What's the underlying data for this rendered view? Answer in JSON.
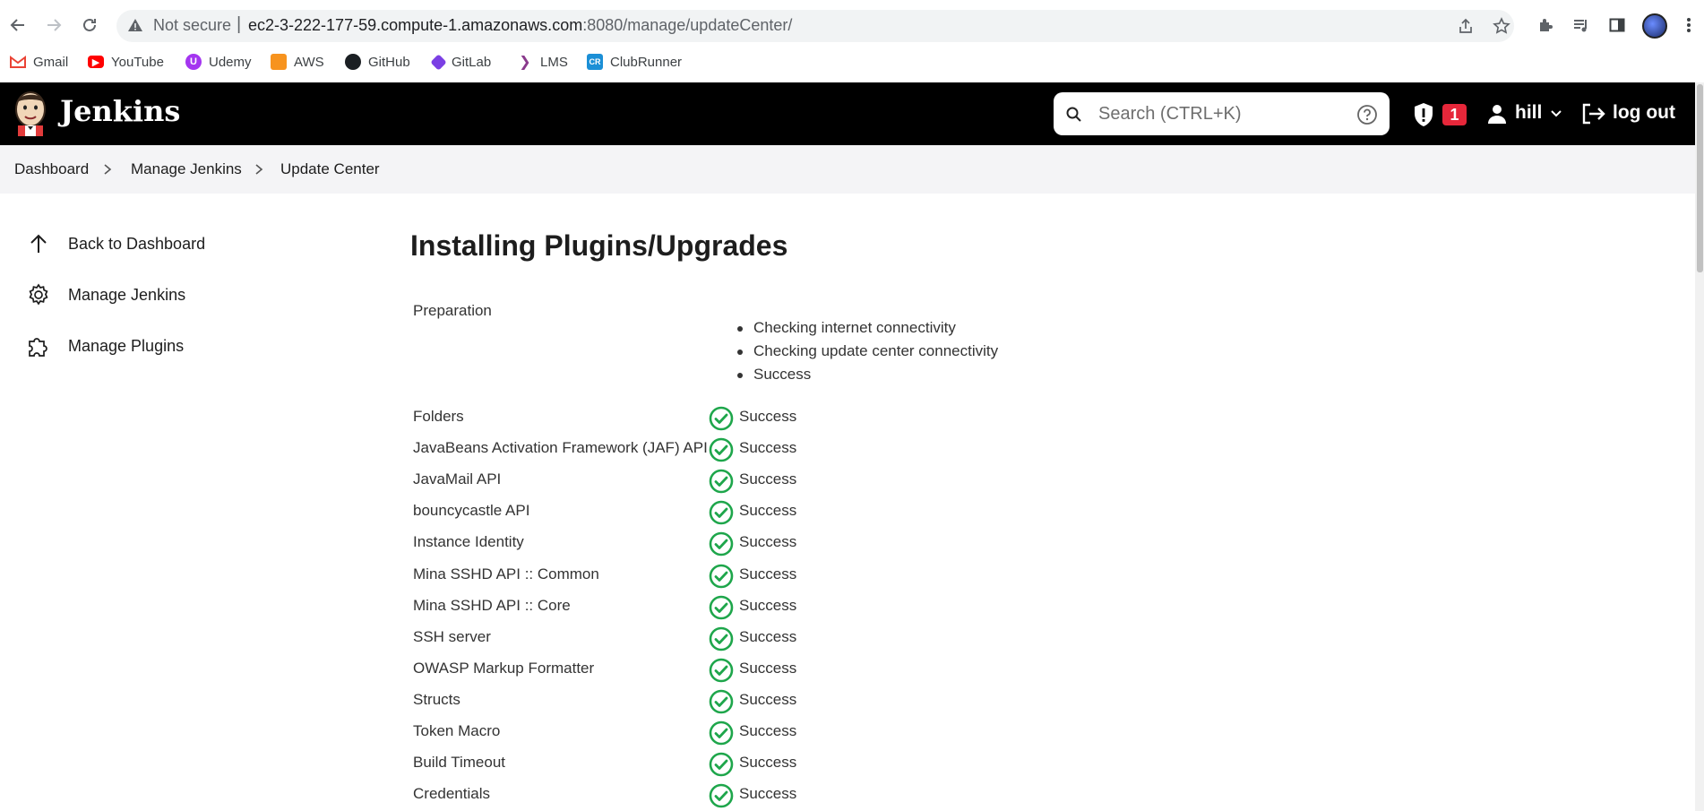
{
  "browser": {
    "security_label": "Not secure",
    "url_host": "ec2-3-222-177-59.compute-1.amazonaws.com",
    "url_rest": ":8080/manage/updateCenter/"
  },
  "bookmarks": [
    {
      "label": "Gmail",
      "icon": "gmail-icon",
      "color": "#ea4335"
    },
    {
      "label": "YouTube",
      "icon": "youtube-icon",
      "color": "#ff0000"
    },
    {
      "label": "Udemy",
      "icon": "udemy-icon",
      "color": "#a435f0"
    },
    {
      "label": "AWS",
      "icon": "aws-icon",
      "color": "#f7931e"
    },
    {
      "label": "GitHub",
      "icon": "github-icon",
      "color": "#1b1f23"
    },
    {
      "label": "GitLab",
      "icon": "gitlab-icon",
      "color": "#7b3fe4"
    },
    {
      "label": "LMS",
      "icon": "lms-icon",
      "color": "#8a3a8c"
    },
    {
      "label": "ClubRunner",
      "icon": "clubrunner-icon",
      "color": "#1b8fd6"
    }
  ],
  "header": {
    "app_title": "Jenkins",
    "search_placeholder": "Search (CTRL+K)",
    "alert_count": "1",
    "username": "hill",
    "logout_label": "log out"
  },
  "breadcrumb": [
    "Dashboard",
    "Manage Jenkins",
    "Update Center"
  ],
  "sidebar": {
    "items": [
      {
        "label": "Back to Dashboard",
        "icon": "arrow-up-icon"
      },
      {
        "label": "Manage Jenkins",
        "icon": "gear-icon"
      },
      {
        "label": "Manage Plugins",
        "icon": "puzzle-icon"
      }
    ]
  },
  "main": {
    "title": "Installing Plugins/Upgrades",
    "preparation": {
      "label": "Preparation",
      "steps": [
        "Checking internet connectivity",
        "Checking update center connectivity",
        "Success"
      ]
    },
    "plugins": [
      {
        "name": "Folders",
        "status": "Success"
      },
      {
        "name": "JavaBeans Activation Framework (JAF) API",
        "status": "Success"
      },
      {
        "name": "JavaMail API",
        "status": "Success"
      },
      {
        "name": "bouncycastle API",
        "status": "Success"
      },
      {
        "name": "Instance Identity",
        "status": "Success"
      },
      {
        "name": "Mina SSHD API :: Common",
        "status": "Success"
      },
      {
        "name": "Mina SSHD API :: Core",
        "status": "Success"
      },
      {
        "name": "SSH server",
        "status": "Success"
      },
      {
        "name": "OWASP Markup Formatter",
        "status": "Success"
      },
      {
        "name": "Structs",
        "status": "Success"
      },
      {
        "name": "Token Macro",
        "status": "Success"
      },
      {
        "name": "Build Timeout",
        "status": "Success"
      },
      {
        "name": "Credentials",
        "status": "Success"
      }
    ]
  },
  "colors": {
    "header_bg": "#000000",
    "success": "#1ea64b",
    "badge": "#e6273a",
    "breadcrumb_bg": "#f4f4f6"
  }
}
